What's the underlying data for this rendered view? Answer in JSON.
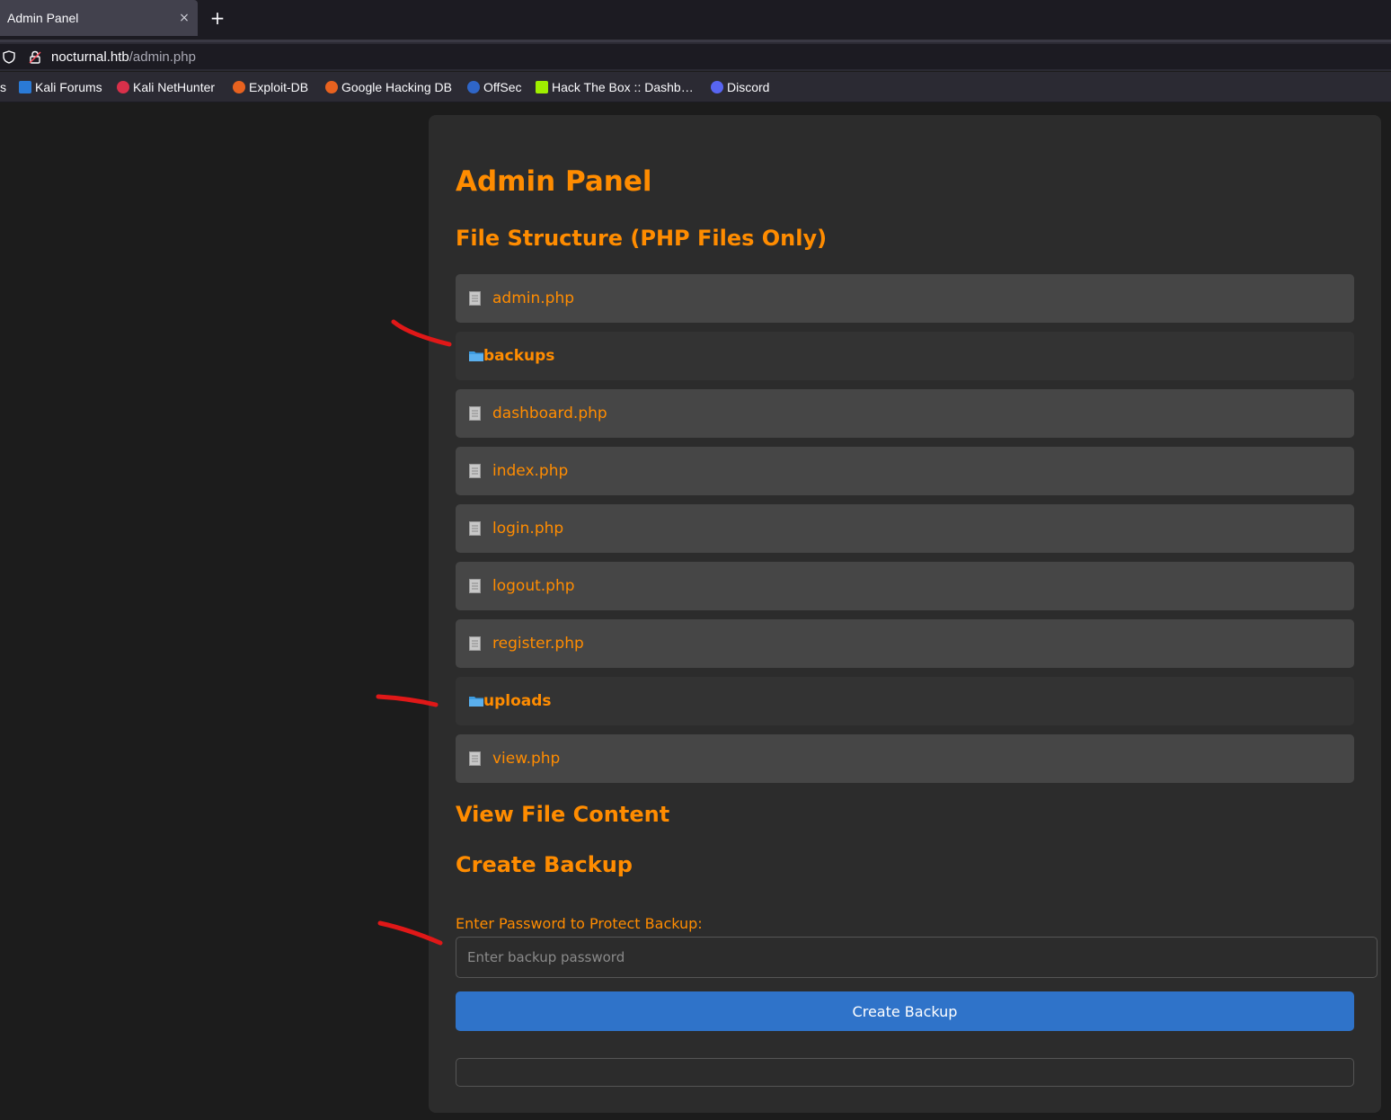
{
  "browser": {
    "tab_title": "Admin Panel",
    "close_glyph": "×",
    "new_tab_glyph": "+",
    "url_host": "nocturnal.htb",
    "url_path": "/admin.php",
    "bookmarks": [
      {
        "label": "s"
      },
      {
        "label": "Kali Forums"
      },
      {
        "label": "Kali NetHunter"
      },
      {
        "label": "Exploit-DB"
      },
      {
        "label": "Google Hacking DB"
      },
      {
        "label": "OffSec"
      },
      {
        "label": "Hack The Box :: Dashb…"
      },
      {
        "label": "Discord"
      }
    ]
  },
  "page": {
    "title": "Admin Panel",
    "file_structure_heading": "File Structure (PHP Files Only)",
    "files": [
      {
        "name": "admin.php",
        "type": "file"
      },
      {
        "name": "backups",
        "type": "folder"
      },
      {
        "name": "dashboard.php",
        "type": "file"
      },
      {
        "name": "index.php",
        "type": "file"
      },
      {
        "name": "login.php",
        "type": "file"
      },
      {
        "name": "logout.php",
        "type": "file"
      },
      {
        "name": "register.php",
        "type": "file"
      },
      {
        "name": "uploads",
        "type": "folder"
      },
      {
        "name": "view.php",
        "type": "file"
      }
    ],
    "view_heading": "View File Content",
    "backup_heading": "Create Backup",
    "password_label": "Enter Password to Protect Backup:",
    "password_placeholder": "Enter backup password",
    "button_label": "Create Backup"
  },
  "colors": {
    "accent": "#ff8c00",
    "button": "#2f73c9",
    "panel": "#2c2c2c",
    "annotation": "#e01818"
  }
}
